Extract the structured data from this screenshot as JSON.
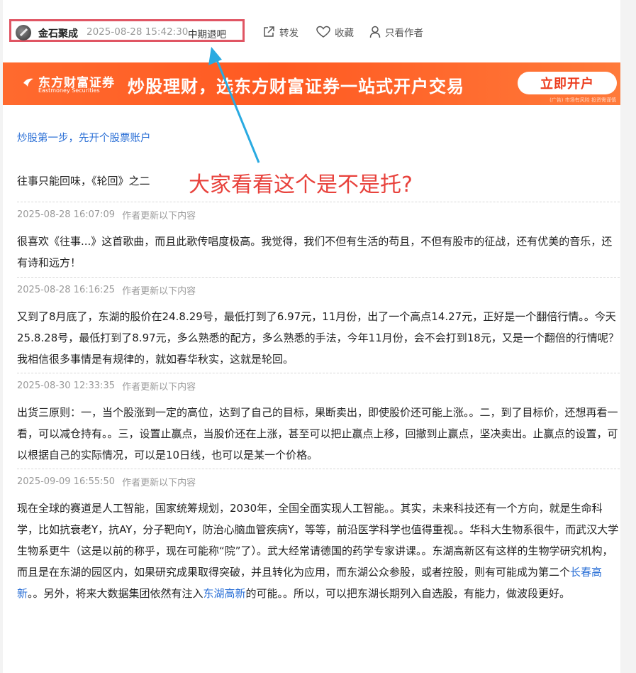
{
  "author": {
    "name": "金石聚成",
    "post_time": "2025-08-28 15:42:30",
    "source": "中期退吧"
  },
  "actions": {
    "share": "转发",
    "favorite": "收藏",
    "author_only": "只看作者"
  },
  "banner": {
    "logo_cn": "东方财富证券",
    "logo_en": "Eastmoney Securities",
    "slogan": "炒股理财，选东方财富证券一站式开户交易",
    "button": "立即开户",
    "note": "(广告) 市场有风险 投资需谨慎"
  },
  "promo_link": "炒股第一步，先开个股票账户",
  "article_title": "往事只能回味，《轮回》之二",
  "annotation": "大家看看这个是不是托?",
  "updates": [
    {
      "time": "2025-08-28 16:07:09",
      "label": "作者更新以下内容",
      "text": "很喜欢《往事...》这首歌曲，而且此歌传唱度极高。我觉得，我们不但有生活的苟且，不但有股市的征战，还有优美的音乐，还有诗和远方！"
    },
    {
      "time": "2025-08-28 16:16:25",
      "label": "作者更新以下内容",
      "text": "又到了8月底了，东湖的股价在24.8.29号，最低打到了6.97元，11月份，出了一个高点14.27元，正好是一个翻倍行情。。今天25.8.28号，最低打到了8.97元，多么熟悉的配方，多么熟悉的手法，今年11月份，会不会打到18元，又是一个翻倍的行情呢？我相信很多事情是有规律的，就如春华秋实，这就是轮回。"
    },
    {
      "time": "2025-08-30 12:33:35",
      "label": "作者更新以下内容",
      "text": "出货三原则：一，当个股涨到一定的高位，达到了自己的目标，果断卖出，即使股价还可能上涨。。二，到了目标价，还想再看一看，可以减仓持有。。三，设置止赢点，当股价还在上涨，甚至可以把止赢点上移，回撤到止赢点，坚决卖出。止赢点的设置，可以根据自己的实际情况，可以是10日线，也可以是某一个价格。"
    },
    {
      "time": "2025-09-09 16:55:50",
      "label": "作者更新以下内容",
      "text_part1": "现在全球的赛道是人工智能，国家统筹规划，2030年，全国全面实现人工智能。。其实，未来科技还有一个方向，就是生命科学，比如抗衰老Y，抗AY，分子靶向Y，防治心脑血管疾病Y，等等，前沿医学科学也值得重视。。华科大生物系很牛，而武汉大学生物系更牛（这是以前的称乎，现在可能称“院”了）。武大经常请德国的药学专家讲课。。东湖高新区有这样的生物学研究机构，而且是在东湖的园区内，如果研究成果取得突破，并且转化为应用，而东湖公众参股，或者控股，则有可能成为第二个",
      "link1": "长春高新",
      "text_part2": "。。另外，将来大数据集团依然有注入",
      "link2": "东湖高新",
      "text_part3": "的可能。。所以，可以把东湖长期列入自选股，有能力，做波段更好。"
    }
  ],
  "colors": {
    "accent_red": "#e05563",
    "link_blue": "#2a6fd6",
    "banner_orange": "#ff5a22",
    "annotation_red": "#e8423c"
  }
}
